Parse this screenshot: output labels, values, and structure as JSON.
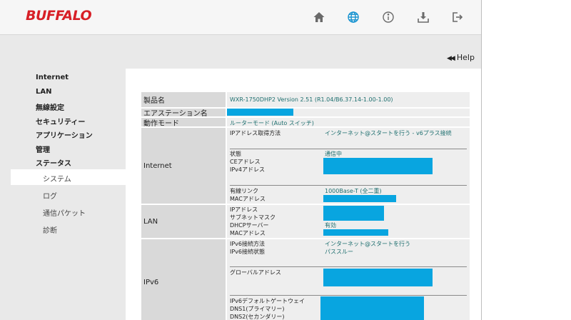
{
  "header": {
    "logo": "BUFFALO",
    "icons": [
      "home-icon",
      "globe-icon",
      "info-icon",
      "download-icon",
      "logout-icon"
    ]
  },
  "help": {
    "label": "Help"
  },
  "sidebar": {
    "items": [
      {
        "label": "Internet"
      },
      {
        "label": "LAN"
      },
      {
        "label": "無線設定"
      },
      {
        "label": "セキュリティー"
      },
      {
        "label": "アプリケーション"
      },
      {
        "label": "管理"
      },
      {
        "label": "ステータス"
      }
    ],
    "sub_items": [
      {
        "label": "システム",
        "active": true
      },
      {
        "label": "ログ"
      },
      {
        "label": "通信パケット"
      },
      {
        "label": "診断"
      }
    ]
  },
  "status": {
    "product": {
      "label": "製品名",
      "value": "WXR-1750DHP2  Version 2.51 (R1.04/B6.37.14-1.00-1.00)"
    },
    "airstation": {
      "label": "エアステーション名"
    },
    "mode": {
      "label": "動作モード",
      "value": "ルーターモード (Auto スイッチ)"
    },
    "internet": {
      "label": "Internet",
      "ip_method_label": "IPアドレス取得方法",
      "ip_method_value": "インターネット@スタートを行う - v6プラス接続",
      "state_label": "状態",
      "state_value": "通信中",
      "ce_label": "CEアドレス",
      "ipv4_label": "IPv4アドレス",
      "wired_label": "有線リンク",
      "wired_value": "1000Base-T (全二重)",
      "mac_label": "MACアドレス"
    },
    "lan": {
      "label": "LAN",
      "ip_label": "IPアドレス",
      "subnet_label": "サブネットマスク",
      "dhcp_label": "DHCPサーバー",
      "dhcp_value": "有効",
      "mac_label": "MACアドレス"
    },
    "ipv6": {
      "label": "IPv6",
      "method_label": "IPv6接続方法",
      "method_value": "インターネット@スタートを行う",
      "state_label": "IPv6接続状態",
      "state_value": "パススルー",
      "global_label": "グローバルアドレス",
      "gateway_label": "IPv6デフォルトゲートウェイ",
      "dns1_label": "DNS1(プライマリー)",
      "dns2_label": "DNS2(セカンダリー)"
    }
  },
  "colors": {
    "accent": "#d71f26",
    "redaction": "#08a5e0",
    "value_text": "#1e6f6f",
    "label_bg": "#d9d9d9",
    "value_bg": "#eeeeee"
  }
}
